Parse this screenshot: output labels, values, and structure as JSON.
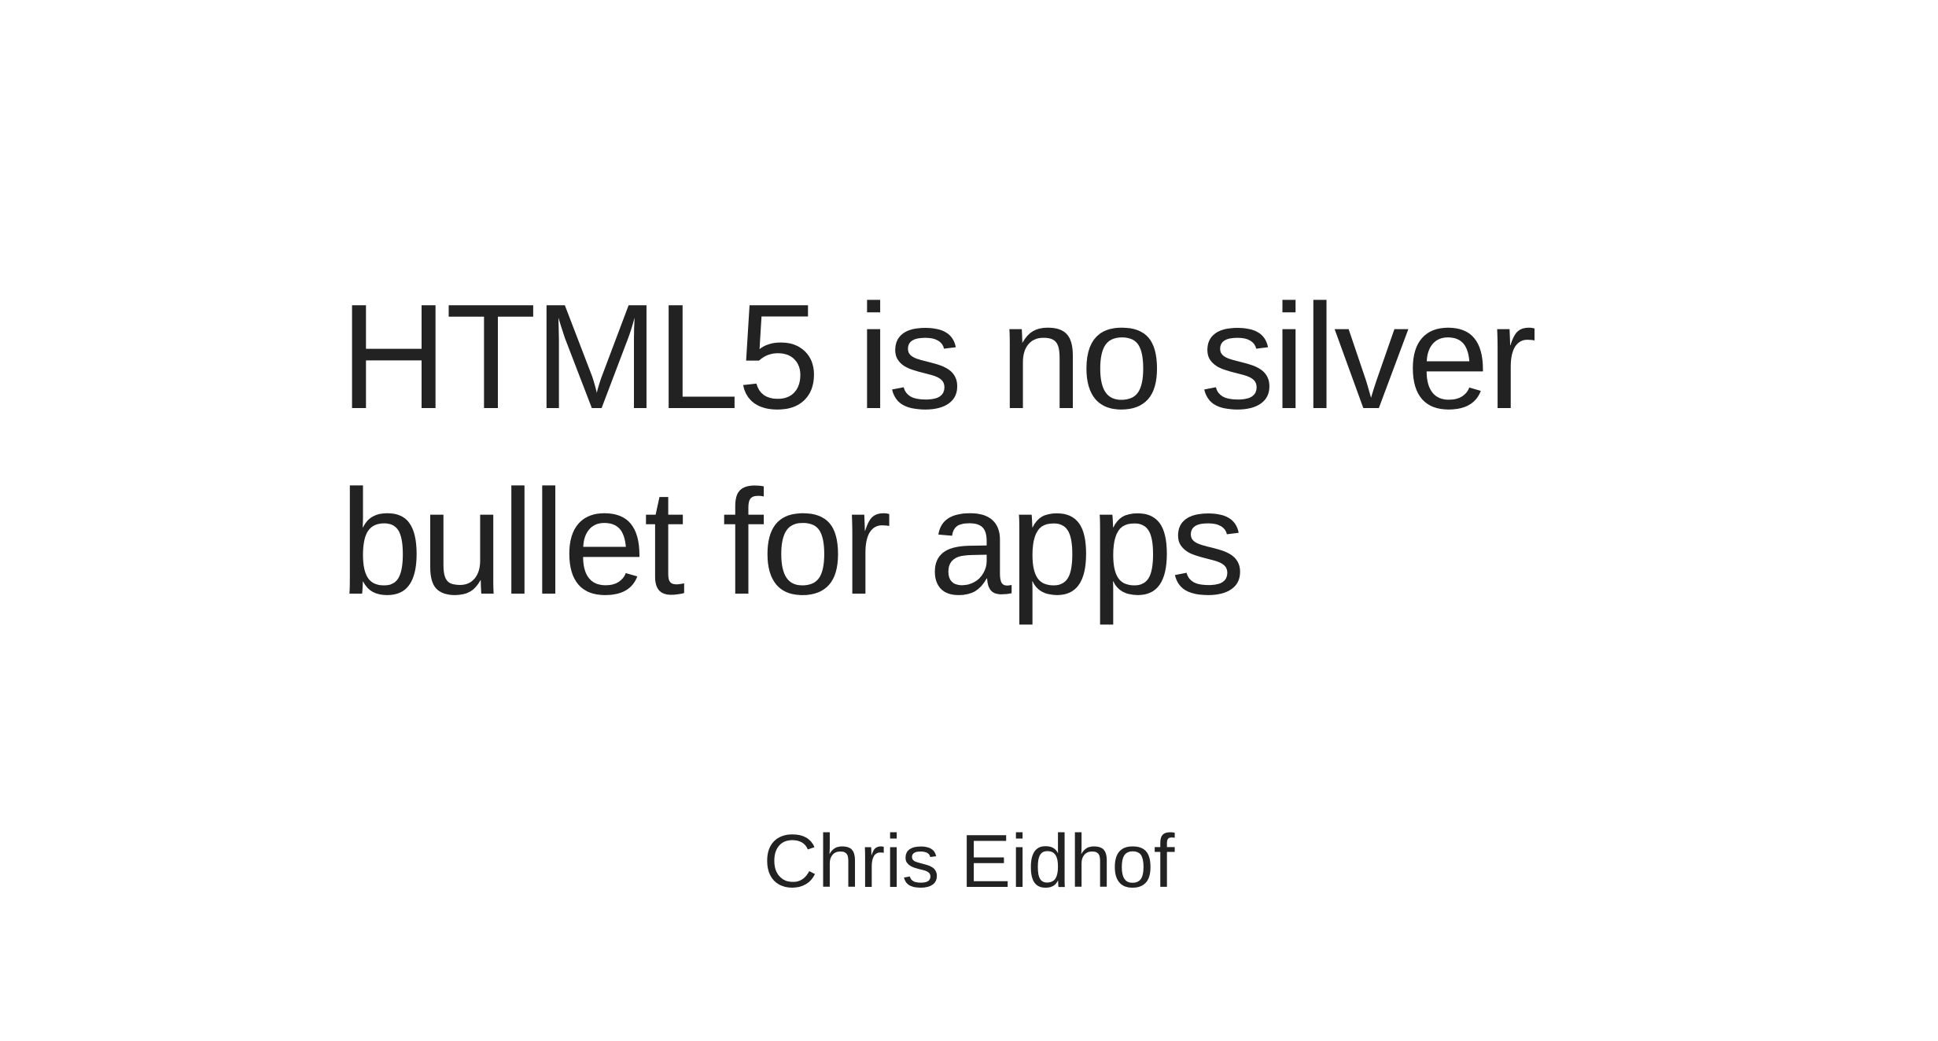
{
  "slide": {
    "title_lines": [
      "HTML5 is no silver",
      "bullet for apps"
    ],
    "author": "Chris Eidhof"
  }
}
